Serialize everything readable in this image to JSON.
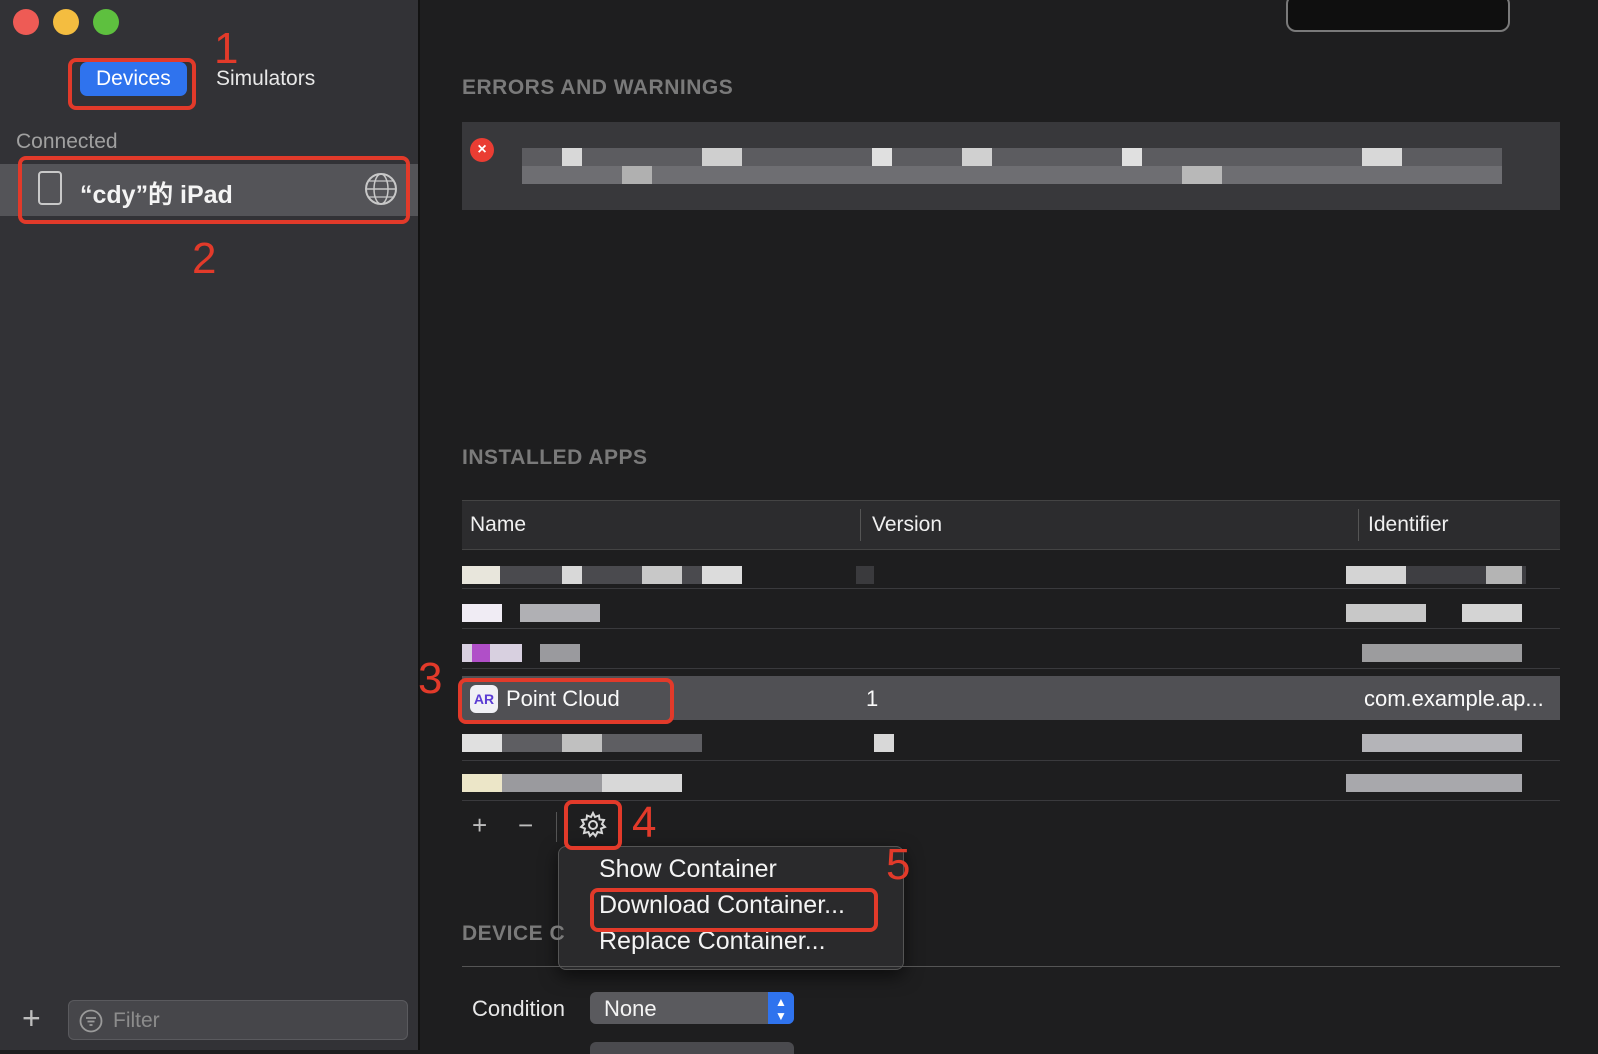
{
  "sidebar": {
    "tabs": {
      "devices": "Devices",
      "simulators": "Simulators"
    },
    "connected_label": "Connected",
    "device_name": "“cdy”的 iPad",
    "filter_placeholder": "Filter",
    "add_label": "+"
  },
  "main": {
    "errors_title": "ERRORS AND WARNINGS",
    "installed_title": "INSTALLED APPS",
    "device_section_title": "DEVICE C",
    "table": {
      "columns": [
        "Name",
        "Version",
        "Identifier"
      ],
      "selected_row": {
        "name": "Point Cloud",
        "version": "1",
        "identifier": "com.example.ap...",
        "icon_text": "AR"
      }
    },
    "toolbar": {
      "add": "+",
      "remove": "−"
    },
    "context_menu": [
      "Show Container",
      "Download Container...",
      "Replace Container..."
    ],
    "condition": {
      "label": "Condition",
      "value": "None"
    }
  },
  "annotations": [
    "1",
    "2",
    "3",
    "4",
    "5"
  ],
  "colors": {
    "accent": "#2f73ee",
    "annotation_red": "#e23a2a",
    "error_red": "#ea3d33"
  }
}
